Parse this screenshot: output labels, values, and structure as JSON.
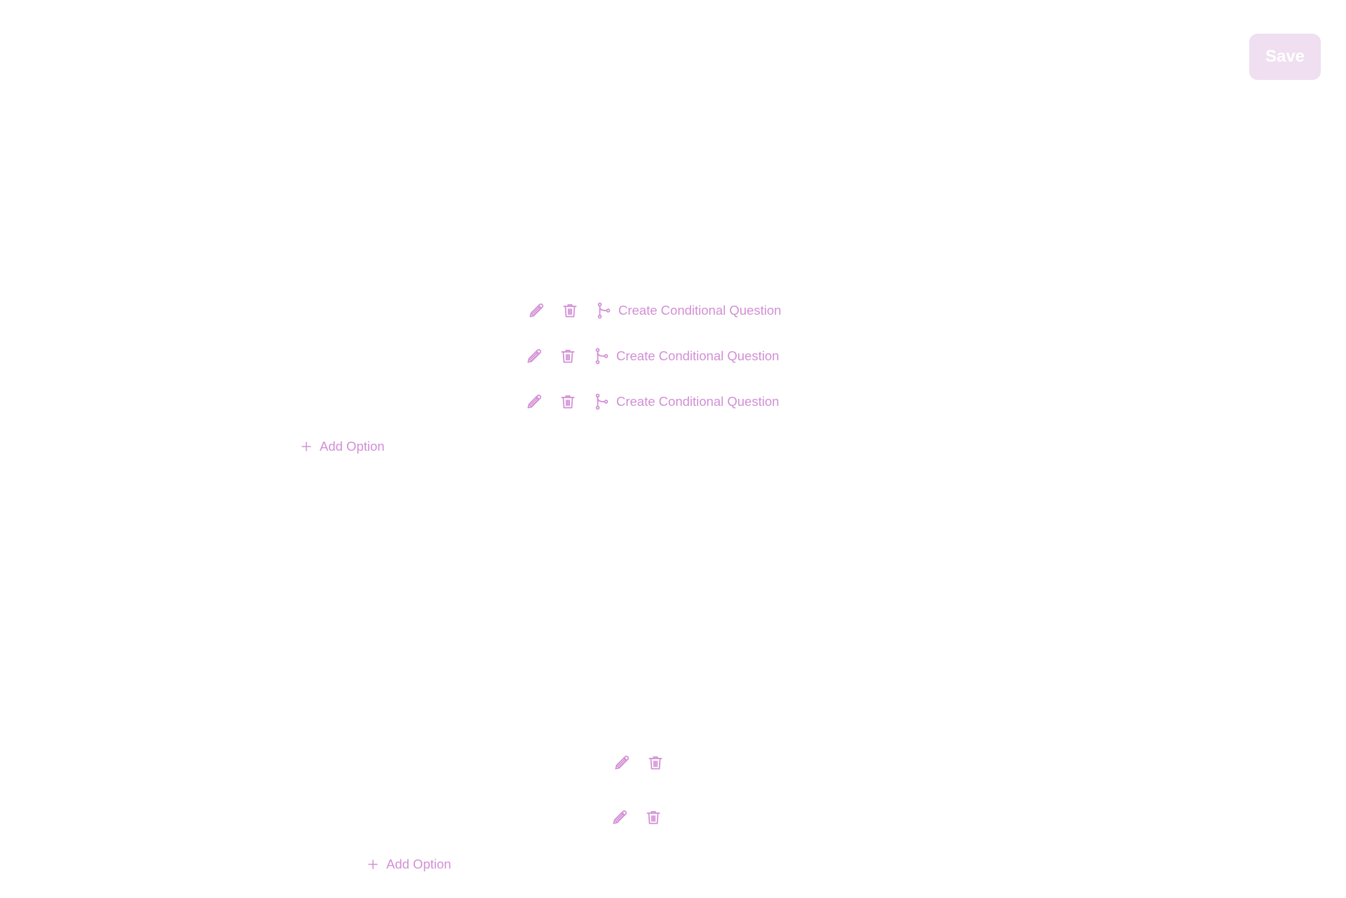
{
  "header": {
    "save_label": "Save"
  },
  "colors": {
    "accent": "#d28fd6",
    "save_button_bg": "#efdff1",
    "save_button_text": "#ffffff",
    "background": "#ffffff"
  },
  "icons": {
    "edit": "pencil-icon",
    "delete": "trash-icon",
    "conditional": "branch-icon",
    "add": "plus-icon"
  },
  "question_1": {
    "options": [
      {
        "conditional_label": "Create Conditional Question"
      },
      {
        "conditional_label": "Create Conditional Question"
      },
      {
        "conditional_label": "Create Conditional Question"
      }
    ],
    "add_option_label": "Add Option"
  },
  "question_2": {
    "options": [
      {},
      {}
    ],
    "add_option_label": "Add Option"
  }
}
